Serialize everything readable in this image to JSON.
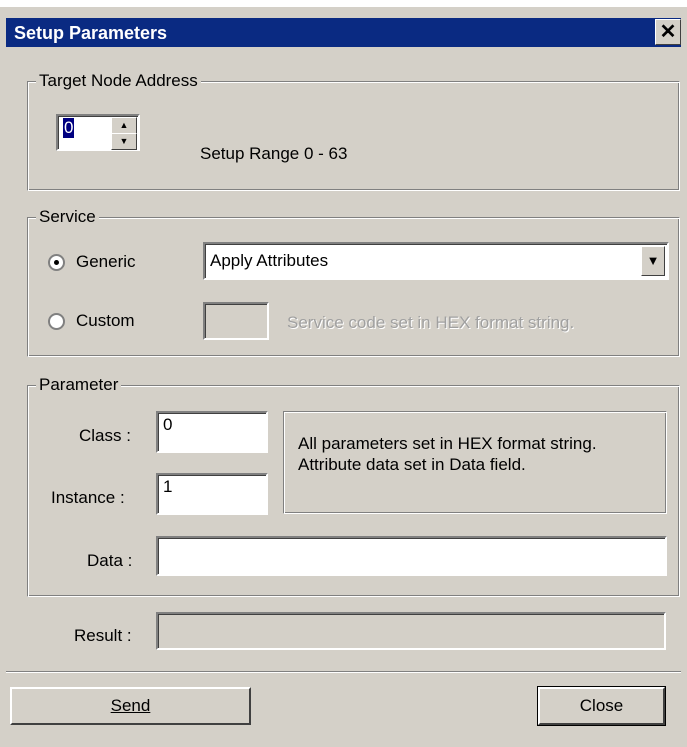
{
  "window": {
    "title": "Setup Parameters",
    "close_glyph": "✕"
  },
  "target": {
    "legend": "Target Node Address",
    "address_value": "0",
    "range_text": "Setup Range 0 - 63",
    "spin_up": "▲",
    "spin_down": "▼"
  },
  "service": {
    "legend": "Service",
    "generic_label": "Generic",
    "custom_label": "Custom",
    "selected": "Generic",
    "generic_value": "Apply Attributes",
    "dropdown_glyph": "▼",
    "custom_value": "",
    "custom_hint": "Service code set in HEX format string."
  },
  "parameter": {
    "legend": "Parameter",
    "class_label": "Class :",
    "class_value": "0",
    "instance_label": "Instance :",
    "instance_value": "1",
    "data_label": "Data :",
    "data_value": "",
    "info_line1": "All parameters set in HEX format string.",
    "info_line2": "Attribute data set in Data field."
  },
  "result": {
    "label": "Result :",
    "value": ""
  },
  "buttons": {
    "send": "Send",
    "close": "Close"
  }
}
